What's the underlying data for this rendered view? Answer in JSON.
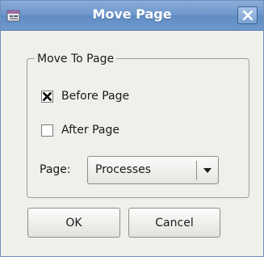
{
  "window": {
    "title": "Move Page",
    "app_icon": "app-icon",
    "close_icon": "close-icon"
  },
  "group": {
    "label": "Move To Page",
    "options": [
      {
        "label": "Before Page",
        "checked": true
      },
      {
        "label": "After Page",
        "checked": false
      }
    ]
  },
  "page_select": {
    "label": "Page:",
    "value": "Processes",
    "arrow_icon": "chevron-down-icon"
  },
  "buttons": {
    "ok": "OK",
    "cancel": "Cancel"
  }
}
